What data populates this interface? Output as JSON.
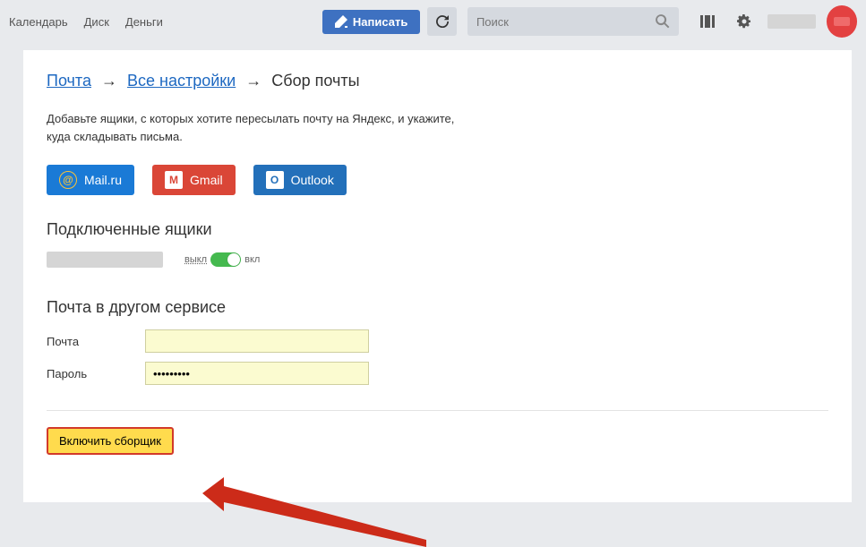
{
  "nav": {
    "calendar": "Календарь",
    "disk": "Диск",
    "money": "Деньги"
  },
  "compose": "Написать",
  "search": {
    "placeholder": "Поиск"
  },
  "breadcrumb": {
    "mail": "Почта",
    "settings": "Все настройки",
    "current": "Сбор почты"
  },
  "desc_line1": "Добавьте ящики, с которых хотите пересылать почту на Яндекс, и укажите,",
  "desc_line2": "куда складывать письма.",
  "providers": {
    "mail": "Mail.ru",
    "gmail": "Gmail",
    "outlook": "Outlook"
  },
  "connected_heading": "Подключенные ящики",
  "toggle": {
    "off": "выкл",
    "on": "вкл"
  },
  "other_heading": "Почта в другом сервисе",
  "form": {
    "email_label": "Почта",
    "password_label": "Пароль",
    "password_value": "•••••••••"
  },
  "submit": "Включить сборщик"
}
